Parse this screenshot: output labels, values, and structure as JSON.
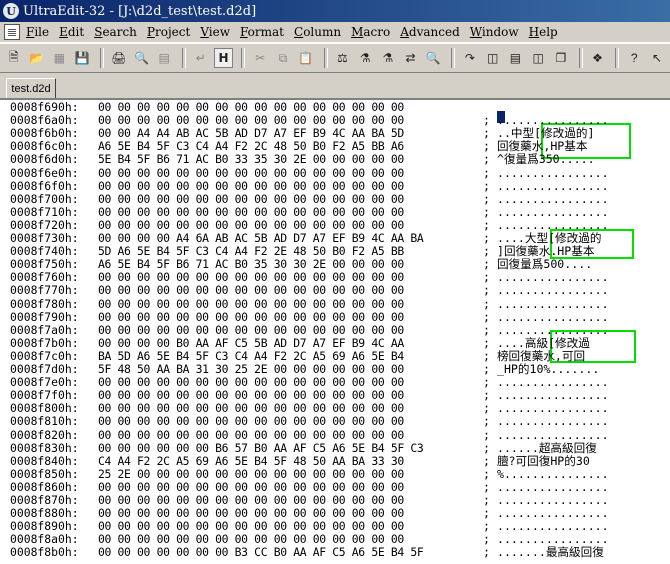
{
  "window": {
    "title": "UltraEdit-32 - [J:\\d2d_test\\test.d2d]",
    "app_icon_letter": "U"
  },
  "menu": [
    "File",
    "Edit",
    "Search",
    "Project",
    "View",
    "Format",
    "Column",
    "Macro",
    "Advanced",
    "Window",
    "Help"
  ],
  "tab": {
    "label": "test.d2d"
  },
  "hex_rows": [
    {
      "addr": "0008f690h:",
      "bytes": "00 00 00 00 00 00 00 00 00 00 00 00 00 00 00 00",
      "ascii": ""
    },
    {
      "addr": "0008f6a0h:",
      "bytes": "00 00 00 00 00 00 00 00 00 00 00 00 00 00 00 00",
      "ascii": "; ................"
    },
    {
      "addr": "0008f6b0h:",
      "bytes": "00 00 A4 A4 AB AC 5B AD D7 A7 EF B9 4C AA BA 5D",
      "ascii": "; ..中型[修改過的]"
    },
    {
      "addr": "0008f6c0h:",
      "bytes": "A6 5E B4 5F C3 C4 A4 F2 2C 48 50 B0 F2 A5 BB A6",
      "ascii": "; 回復藥水,HP基本"
    },
    {
      "addr": "0008f6d0h:",
      "bytes": "5E B4 5F B6 71 AC B0 33 35 30 2E 00 00 00 00 00",
      "ascii": "; ^復量爲350....."
    },
    {
      "addr": "0008f6e0h:",
      "bytes": "00 00 00 00 00 00 00 00 00 00 00 00 00 00 00 00",
      "ascii": "; ................"
    },
    {
      "addr": "0008f6f0h:",
      "bytes": "00 00 00 00 00 00 00 00 00 00 00 00 00 00 00 00",
      "ascii": "; ................"
    },
    {
      "addr": "0008f700h:",
      "bytes": "00 00 00 00 00 00 00 00 00 00 00 00 00 00 00 00",
      "ascii": "; ................"
    },
    {
      "addr": "0008f710h:",
      "bytes": "00 00 00 00 00 00 00 00 00 00 00 00 00 00 00 00",
      "ascii": "; ................"
    },
    {
      "addr": "0008f720h:",
      "bytes": "00 00 00 00 00 00 00 00 00 00 00 00 00 00 00 00",
      "ascii": "; ................"
    },
    {
      "addr": "0008f730h:",
      "bytes": "00 00 00 00 A4 6A AB AC 5B AD D7 A7 EF B9 4C AA BA",
      "ascii": "; ....大型[修改過的"
    },
    {
      "addr": "0008f740h:",
      "bytes": "5D A6 5E B4 5F C3 C4 A4 F2 2E 48 50 B0 F2 A5 BB",
      "ascii": "; ]回復藥水.HP基本"
    },
    {
      "addr": "0008f750h:",
      "bytes": "A6 5E B4 5F B6 71 AC B0 35 30 30 2E 00 00 00 00",
      "ascii": "; 回復量爲500...."
    },
    {
      "addr": "0008f760h:",
      "bytes": "00 00 00 00 00 00 00 00 00 00 00 00 00 00 00 00",
      "ascii": "; ................"
    },
    {
      "addr": "0008f770h:",
      "bytes": "00 00 00 00 00 00 00 00 00 00 00 00 00 00 00 00",
      "ascii": "; ................"
    },
    {
      "addr": "0008f780h:",
      "bytes": "00 00 00 00 00 00 00 00 00 00 00 00 00 00 00 00",
      "ascii": "; ................"
    },
    {
      "addr": "0008f790h:",
      "bytes": "00 00 00 00 00 00 00 00 00 00 00 00 00 00 00 00",
      "ascii": "; ................"
    },
    {
      "addr": "0008f7a0h:",
      "bytes": "00 00 00 00 00 00 00 00 00 00 00 00 00 00 00 00",
      "ascii": "; ................"
    },
    {
      "addr": "0008f7b0h:",
      "bytes": "00 00 00 00 B0 AA AF C5 5B AD D7 A7 EF B9 4C AA",
      "ascii": "; ....高級[修改過"
    },
    {
      "addr": "0008f7c0h:",
      "bytes": "BA 5D A6 5E B4 5F C3 C4 A4 F2 2C A5 69 A6 5E B4",
      "ascii": "; 榜回復藥水,可回"
    },
    {
      "addr": "0008f7d0h:",
      "bytes": "5F 48 50 AA BA 31 30 25 2E 00 00 00 00 00 00 00",
      "ascii": "; _HP的10%......."
    },
    {
      "addr": "0008f7e0h:",
      "bytes": "00 00 00 00 00 00 00 00 00 00 00 00 00 00 00 00",
      "ascii": "; ................"
    },
    {
      "addr": "0008f7f0h:",
      "bytes": "00 00 00 00 00 00 00 00 00 00 00 00 00 00 00 00",
      "ascii": "; ................"
    },
    {
      "addr": "0008f800h:",
      "bytes": "00 00 00 00 00 00 00 00 00 00 00 00 00 00 00 00",
      "ascii": "; ................"
    },
    {
      "addr": "0008f810h:",
      "bytes": "00 00 00 00 00 00 00 00 00 00 00 00 00 00 00 00",
      "ascii": "; ................"
    },
    {
      "addr": "0008f820h:",
      "bytes": "00 00 00 00 00 00 00 00 00 00 00 00 00 00 00 00",
      "ascii": "; ................"
    },
    {
      "addr": "0008f830h:",
      "bytes": "00 00 00 00 00 00 B6 57 B0 AA AF C5 A6 5E B4 5F C3",
      "ascii": "; ......超高級回復"
    },
    {
      "addr": "0008f840h:",
      "bytes": "C4 A4 F2 2C A5 69 A6 5E B4 5F 48 50 AA BA 33 30",
      "ascii": "; 膻?可回復HP的30"
    },
    {
      "addr": "0008f850h:",
      "bytes": "25 2E 00 00 00 00 00 00 00 00 00 00 00 00 00 00",
      "ascii": "; %..............."
    },
    {
      "addr": "0008f860h:",
      "bytes": "00 00 00 00 00 00 00 00 00 00 00 00 00 00 00 00",
      "ascii": "; ................"
    },
    {
      "addr": "0008f870h:",
      "bytes": "00 00 00 00 00 00 00 00 00 00 00 00 00 00 00 00",
      "ascii": "; ................"
    },
    {
      "addr": "0008f880h:",
      "bytes": "00 00 00 00 00 00 00 00 00 00 00 00 00 00 00 00",
      "ascii": "; ................"
    },
    {
      "addr": "0008f890h:",
      "bytes": "00 00 00 00 00 00 00 00 00 00 00 00 00 00 00 00",
      "ascii": "; ................"
    },
    {
      "addr": "0008f8a0h:",
      "bytes": "00 00 00 00 00 00 00 00 00 00 00 00 00 00 00 00",
      "ascii": "; ................"
    },
    {
      "addr": "0008f8b0h:",
      "bytes": "00 00 00 00 00 00 00 B3 CC B0 AA AF C5 A6 5E B4 5F",
      "ascii": "; .......最高級回復"
    }
  ],
  "colors": {
    "highlight": "#00e000",
    "cursor": "#0a246a"
  }
}
